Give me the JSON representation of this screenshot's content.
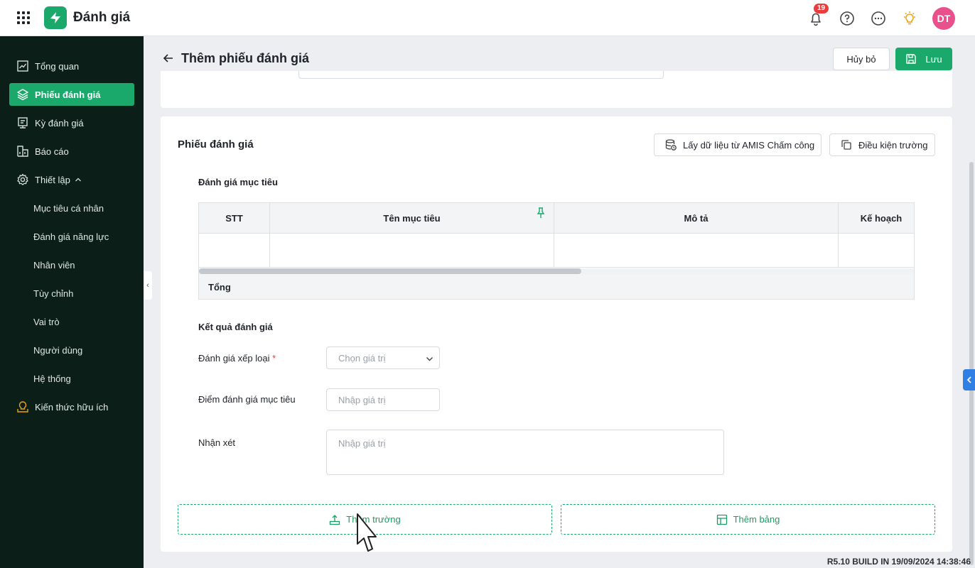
{
  "app": {
    "title": "Đánh giá",
    "notifications": "19",
    "avatar": "DT"
  },
  "sidebar": {
    "items": [
      {
        "label": "Tổng quan",
        "icon": "chart-line-icon"
      },
      {
        "label": "Phiếu đánh giá",
        "icon": "layers-icon",
        "active": true
      },
      {
        "label": "Kỳ đánh giá",
        "icon": "calendar-icon"
      },
      {
        "label": "Báo cáo",
        "icon": "report-icon"
      },
      {
        "label": "Thiết lập",
        "icon": "gear-icon"
      }
    ],
    "sub_items": [
      "Mục tiêu cá nhân",
      "Đánh giá năng lực",
      "Nhân viên",
      "Tùy chỉnh",
      "Vai trò",
      "Người dùng",
      "Hệ thống"
    ],
    "knowledge": "Kiến thức hữu ích"
  },
  "header": {
    "title": "Thêm phiếu đánh giá",
    "cancel": "Hủy bỏ",
    "save": "Lưu"
  },
  "form": {
    "title": "Phiếu đánh giá",
    "btn_fetch": "Lấy dữ liệu từ AMIS Chấm công",
    "btn_condition": "Điều kiện trường",
    "goals": {
      "title": "Đánh giá mục tiêu",
      "columns": [
        "STT",
        "Tên mục tiêu",
        "Mô tả",
        "Kế hoạch"
      ],
      "total": "Tổng"
    },
    "result": {
      "title": "Kết quả đánh giá",
      "rank_label": "Đánh giá xếp loại",
      "rank_required": "*",
      "rank_placeholder": "Chọn giá trị",
      "score_label": "Điểm đánh giá mục tiêu",
      "score_placeholder": "Nhập giá trị",
      "comment_label": "Nhận xét",
      "comment_placeholder": "Nhập giá trị"
    },
    "add_field": "Thêm trường",
    "add_table": "Thêm bảng"
  },
  "build": "R5.10 BUILD IN 19/09/2024 14:38:46",
  "colors": {
    "brand": "#1aa86b",
    "sidebar": "#0b1f18",
    "badge": "#ec3b3b",
    "avatar": "#e9518c",
    "side_tab": "#2f7fe5"
  }
}
